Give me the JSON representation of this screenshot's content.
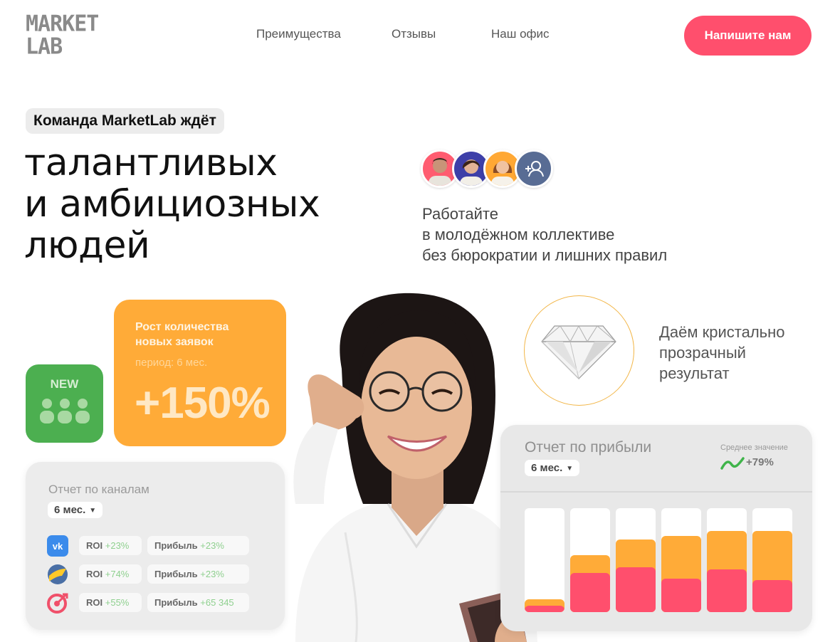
{
  "header": {
    "logo_line1": "MARKET",
    "logo_line2": "LAB",
    "nav": [
      "Преимущества",
      "Отзывы",
      "Наш офис"
    ],
    "cta": "Напишите нам"
  },
  "hero": {
    "tag": "Команда MarketLab ждёт",
    "headline": [
      "талантливых",
      "и амбициозных",
      "людей"
    ],
    "subtitle": [
      "Работайте",
      "в молодёжном коллективе",
      "без бюрократии и лишних правил"
    ]
  },
  "new_card": {
    "label": "NEW",
    "icon": "team-icon"
  },
  "growth_card": {
    "title": [
      "Рост количества",
      "новых заявок"
    ],
    "period": "период: 6 мес.",
    "value": "+150%"
  },
  "diamond": {
    "icon": "diamond-icon",
    "text": [
      "Даём кристально",
      "прозрачный",
      "результат"
    ]
  },
  "channels_report": {
    "title": "Отчет по каналам",
    "period": "6 мес.",
    "rows": [
      {
        "icon": "vk-icon",
        "roi_label": "ROI",
        "roi": "+23%",
        "profit_label": "Прибыль",
        "profit": "+23%"
      },
      {
        "icon": "yandex-icon",
        "roi_label": "ROI",
        "roi": "+74%",
        "profit_label": "Прибыль",
        "profit": "+23%"
      },
      {
        "icon": "target-icon",
        "roi_label": "ROI",
        "roi": "+55%",
        "profit_label": "Прибыль",
        "profit": "+65 345"
      }
    ]
  },
  "profit_report": {
    "title": "Отчет по прибыли",
    "period": "6 мес.",
    "avg_label": "Среднее значение",
    "avg_value": "+79%",
    "colors": {
      "orange": "#ffab38",
      "red": "#ff4f6d"
    },
    "bars": [
      {
        "orange": 0.12,
        "red": 0.06
      },
      {
        "orange": 0.55,
        "red": 0.38
      },
      {
        "orange": 0.7,
        "red": 0.43
      },
      {
        "orange": 0.73,
        "red": 0.32
      },
      {
        "orange": 0.78,
        "red": 0.41
      },
      {
        "orange": 0.78,
        "red": 0.31
      }
    ]
  }
}
